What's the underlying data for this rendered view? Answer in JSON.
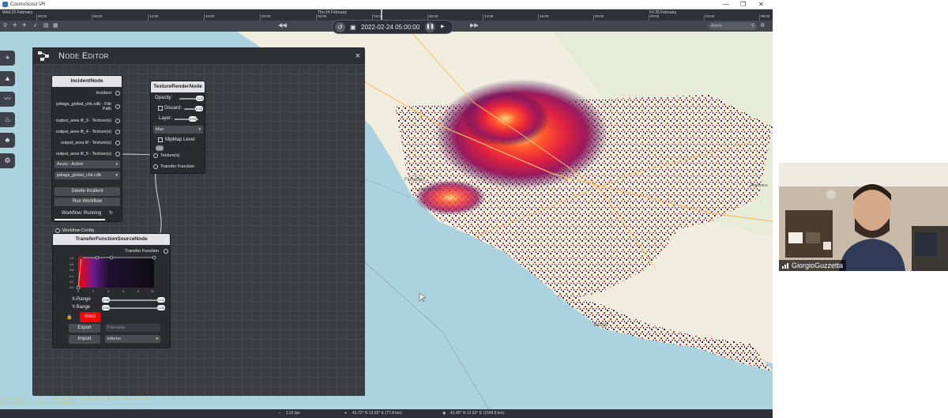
{
  "window": {
    "title": "CosmoScout VR",
    "controls": [
      "—",
      "❐",
      "✕"
    ]
  },
  "timeline": {
    "days": [
      {
        "label": "Wed 23 February"
      },
      {
        "label": "Thu 24 February"
      },
      {
        "label": "Fri 25 February"
      }
    ],
    "ticks": [
      "04:00",
      "08:00",
      "12:00",
      "16:00",
      "20:00",
      "00:00",
      "04:00",
      "08:00",
      "12:00",
      "16:00",
      "20:00",
      "00:00",
      "04:00",
      "08:00"
    ]
  },
  "toolbar": {
    "datetime": "2022-02-24 05:00:00",
    "history_icon": "history-icon",
    "pause_icon": "pause-icon",
    "search_value": "Anzio",
    "search_icon": "search-icon"
  },
  "sidebar": {
    "items": [
      {
        "icon": "location-pin-icon"
      },
      {
        "icon": "mountain-icon"
      },
      {
        "icon": "trend-line-icon"
      },
      {
        "icon": "fire-icon"
      },
      {
        "icon": "tree-icon"
      },
      {
        "icon": "gear-icon"
      }
    ]
  },
  "node_editor": {
    "title": "Node Editor",
    "close": "×",
    "incident_node": {
      "title": "IncidentNode",
      "outputs": [
        "Incident",
        "pdiags_global_chk.cdb - File Path",
        "output_area lif_3 - Texture(s)",
        "output_area lif_4 - Texture(s)",
        "output_area lif - Texture(s)",
        "output_area lif_5 - Texture(s)"
      ],
      "incident_select": "Anzio - Active",
      "file_select": "pdiags_global_chk.cdb",
      "delete_button": "Delete Incident",
      "run_button": "Run Workflow",
      "status": "Workflow: Running",
      "config_label": "Workflow Config"
    },
    "texture_node": {
      "title": "TextureRenderNode",
      "opacity_label": "Opacity:",
      "opacity_value": "1.00",
      "discard_label": "Discard:",
      "discard_value": "0.00",
      "layer_label": "Layer:",
      "layer_value": "0.00",
      "blend_select": "Max",
      "mipmap_label": "MipMap Level:",
      "mipmap_value": "0.00",
      "input_texture": "Texture(s)",
      "input_tf": "Transfer Function"
    },
    "tf_node": {
      "title": "TransferFunctionSourceNode",
      "output": "Transfer Function",
      "y_ticks": [
        "1.0",
        "0.8",
        "0.6",
        "0.4",
        "0.2",
        "0.0"
      ],
      "x_ticks": [
        "0",
        "2",
        "4",
        "6",
        "8",
        "10"
      ],
      "xrange_label": "X-Range",
      "xrange_min": "0.00",
      "xrange_max": "1.00",
      "yrange_label": "Y-Range",
      "yrange_min": "0.00",
      "yrange_max": "1.00",
      "color_hex": "ff0000",
      "export_button": "Export",
      "import_button": "Import",
      "filename_placeholder": "Filename",
      "preset_select": "inferno"
    }
  },
  "map": {
    "place_labels": [
      "Anzio",
      "Fiumicino",
      "Lido di Ostia",
      "Avezzano"
    ]
  },
  "console": {
    "lines": [
      "[E] ce-grpc: ...........  The process is busy and has not been restarted.",
      "             Use shortcut to force it to complete"
    ]
  },
  "statusbar": {
    "fps": "1.91 fps",
    "fps_icon": "gauge-icon",
    "pointer_coords": "41.72° N 12.62° E (77.8 km)",
    "pointer_icon": "pointer-icon",
    "camera_coords": "41.45° N 12.62° E (1548.8 km)",
    "camera_icon": "camera-icon"
  },
  "webcam": {
    "name": "GiorgioGuzzetta",
    "signal_icon": "signal-bars-icon"
  },
  "colors": {
    "accent_red": "#ff0000",
    "panel_bg": "#3b3d42",
    "node_header": "#e4e4e8"
  }
}
